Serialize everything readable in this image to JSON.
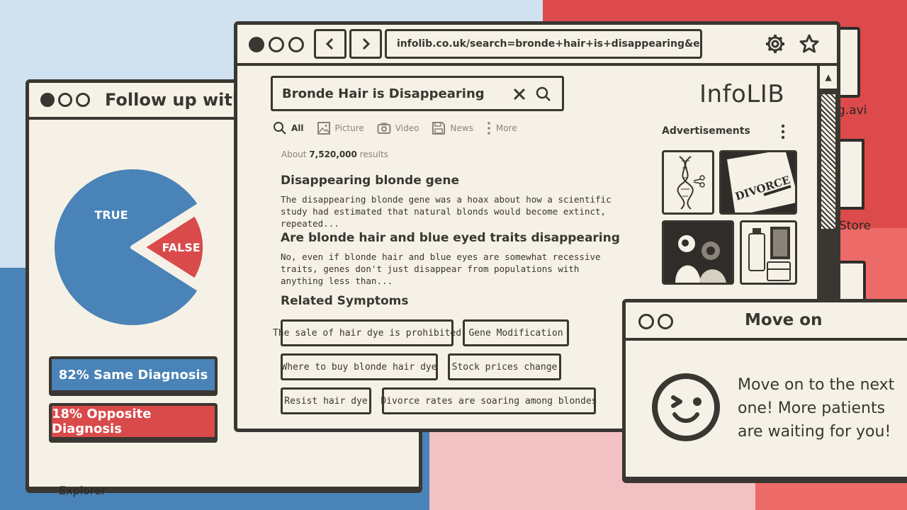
{
  "desktop": {
    "items": [
      "g.avi",
      "Store",
      "Explorer"
    ]
  },
  "left_window": {
    "title": "Follow up with",
    "chart_data": {
      "type": "pie",
      "categories": [
        "TRUE",
        "FALSE"
      ],
      "values": [
        82,
        18
      ],
      "colors": [
        "#4983b7",
        "#d94a4b"
      ]
    },
    "diagnosis": {
      "same_label": "82% Same Diagnosis",
      "opposite_label": "18% Opposite Diagnosis"
    }
  },
  "browser": {
    "url": "infolib.co.uk/search=bronde+hair+is+disappearing&ei",
    "search_query": "Bronde Hair is Disappearing",
    "logo": "InfoLIB",
    "filters": [
      "All",
      "Picture",
      "Video",
      "News",
      "More"
    ],
    "about_prefix": "About",
    "about_count": "7,520,000",
    "about_suffix": "results",
    "results": [
      {
        "title": "Disappearing blonde gene",
        "snippet": "The disappearing blonde gene was a hoax about how a scientific study had estimated that natural blonds would become extinct, repeated..."
      },
      {
        "title": "Are blonde hair and blue eyed traits disappearing",
        "snippet": "No, even if blonde hair and blue eyes are somewhat recessive traits, genes don't just disappear from populations with anything less than..."
      }
    ],
    "related_title": "Related Symptoms",
    "related_tags": [
      "The sale of hair dye is prohibited",
      "Gene Modification",
      "Where to buy blonde hair dye",
      "Stock prices change",
      "Resist hair dye",
      "Divorce rates are soaring among blondes"
    ],
    "ads_title": "Advertisements",
    "ad_items": [
      "dna-scissors",
      "divorce-paper",
      "hair-salon",
      "hair-dye-bottles"
    ]
  },
  "move_window": {
    "title": "Move on",
    "message": "Move on to the next one! More patients are waiting for you!"
  }
}
